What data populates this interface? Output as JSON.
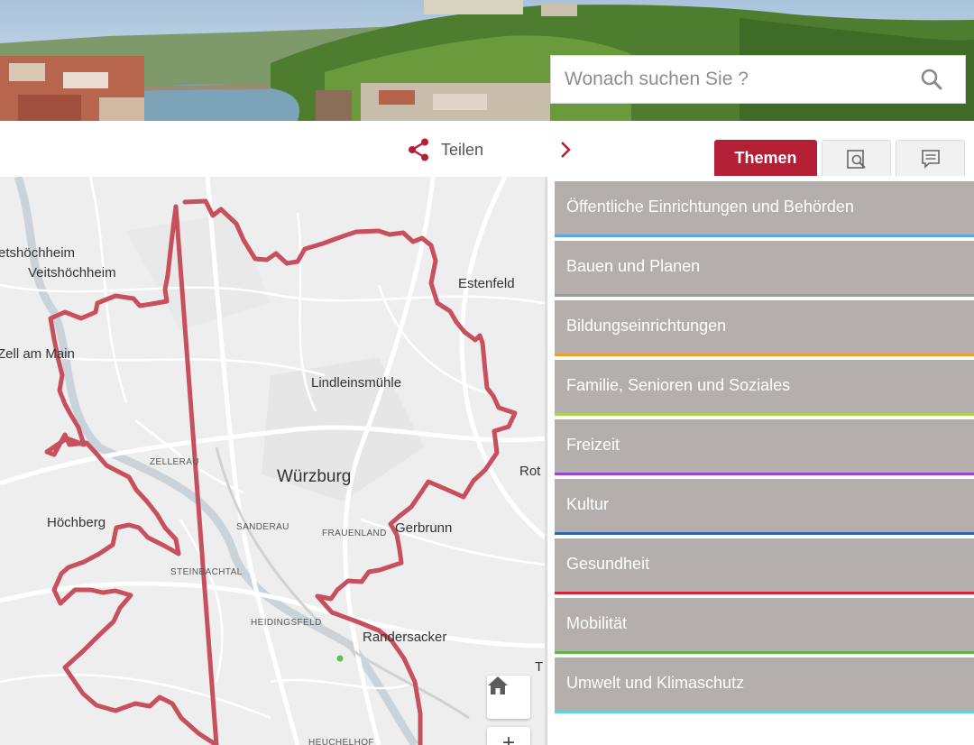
{
  "search": {
    "placeholder": "Wonach suchen Sie ?"
  },
  "toolbar": {
    "share_label": "Teilen",
    "tab_themes": "Themen"
  },
  "map": {
    "labels": {
      "veitshoechheim_cut": "etshöchheim",
      "veitshoechheim": "Veitshöchheim",
      "estenfeld": "Estenfeld",
      "zell": "Zell am Main",
      "lindleinsmuehle": "Lindleinsmühle",
      "zellerau": "ZELLERAU",
      "wuerzburg": "Würzburg",
      "rott": "Rot",
      "hoechberg": "Höchberg",
      "sanderau": "SANDERAU",
      "frauenland": "FRAUENLAND",
      "gerbrunn": "Gerbrunn",
      "steinbachtal": "STEINBACHTAL",
      "heidingsfeld": "HEIDINGSFELD",
      "randersacker": "Randersacker",
      "t_cut": "T",
      "heuchelhof": "HEUCHELHOF"
    },
    "boundary_color": "#c74f5e",
    "zoom_in_label": "+"
  },
  "themes": [
    {
      "label": "Öffentliche Einrichtungen und Behörden",
      "color": "#5aa7e6"
    },
    {
      "label": "Bauen und Planen",
      "color": "#9a9a9a"
    },
    {
      "label": "Bildungseinrichtungen",
      "color": "#f0a028"
    },
    {
      "label": "Familie, Senioren und Soziales",
      "color": "#a8d848"
    },
    {
      "label": "Freizeit",
      "color": "#9b44d8"
    },
    {
      "label": "Kultur",
      "color": "#2e63b8"
    },
    {
      "label": "Gesundheit",
      "color": "#d8213a"
    },
    {
      "label": "Mobilität",
      "color": "#58b946"
    },
    {
      "label": "Umwelt und Klimaschutz",
      "color": "#62d2e0"
    }
  ],
  "colors": {
    "accent": "#b51f35",
    "theme_bg": "#b4afac"
  },
  "icons": {
    "search": "search-icon",
    "share": "share-icon",
    "chevron": "chevron-right-icon",
    "search_tab": "map-search-icon",
    "legend_tab": "legend-icon",
    "home": "home-icon"
  }
}
